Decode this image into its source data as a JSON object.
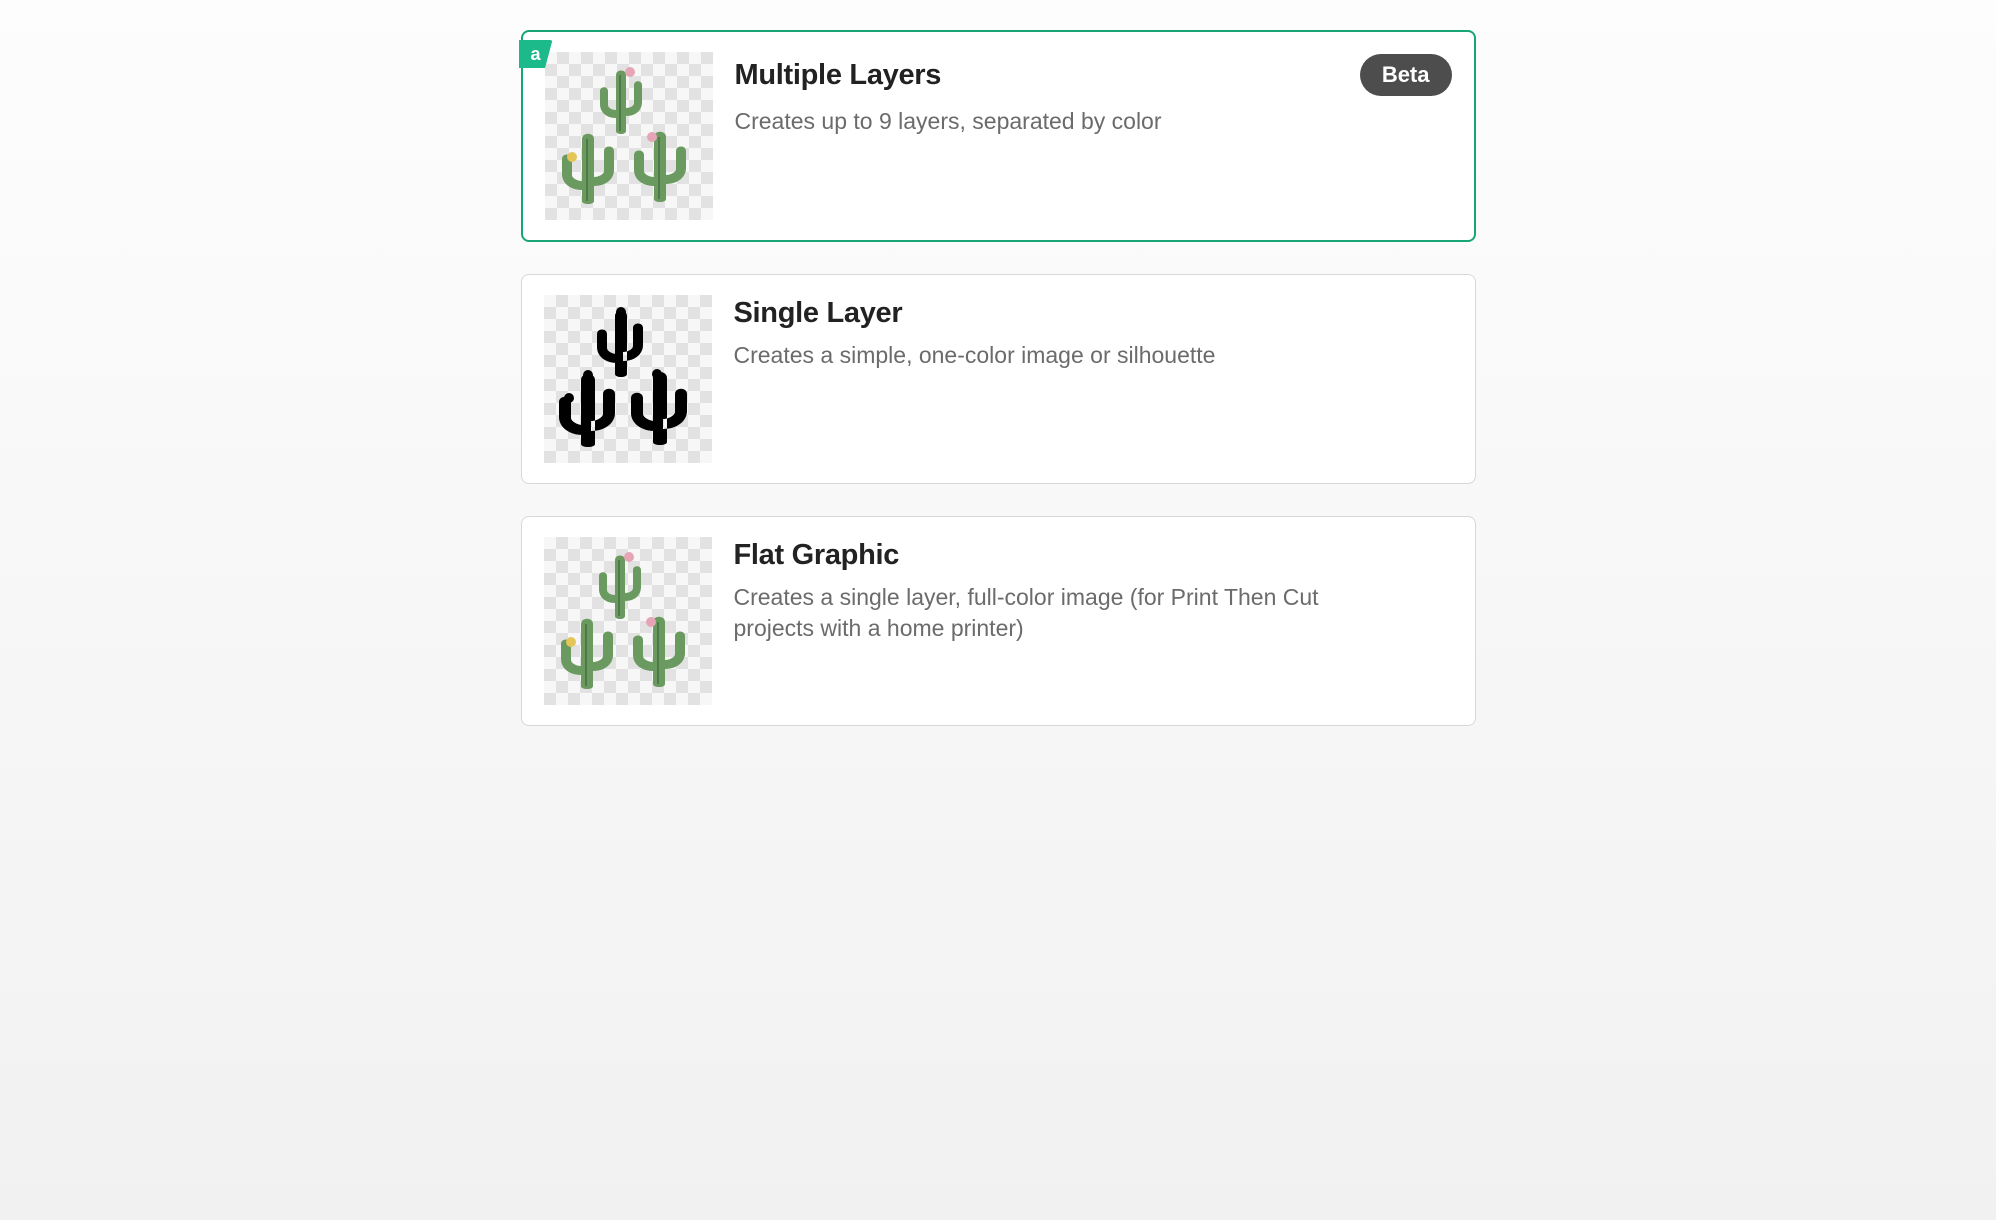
{
  "options": [
    {
      "id": "multiple-layers",
      "title": "Multiple Layers",
      "description": "Creates up to 9 layers, separated by color",
      "selected": true,
      "badge": "Beta",
      "ribbon": "a",
      "preview_style": "color"
    },
    {
      "id": "single-layer",
      "title": "Single Layer",
      "description": "Creates a simple, one-color image or silhouette",
      "selected": false,
      "badge": null,
      "ribbon": null,
      "preview_style": "silhouette"
    },
    {
      "id": "flat-graphic",
      "title": "Flat Graphic",
      "description": "Creates a single layer, full-color image (for Print Then Cut projects with a home printer)",
      "selected": false,
      "badge": null,
      "ribbon": null,
      "preview_style": "color"
    }
  ],
  "colors": {
    "accent": "#17a673",
    "badge_bg": "#4d4d4d",
    "cactus_body": "#6b9a60",
    "cactus_dark": "#4e7a47",
    "flower_pink": "#e6a5b6",
    "flower_yellow": "#e4c557"
  }
}
